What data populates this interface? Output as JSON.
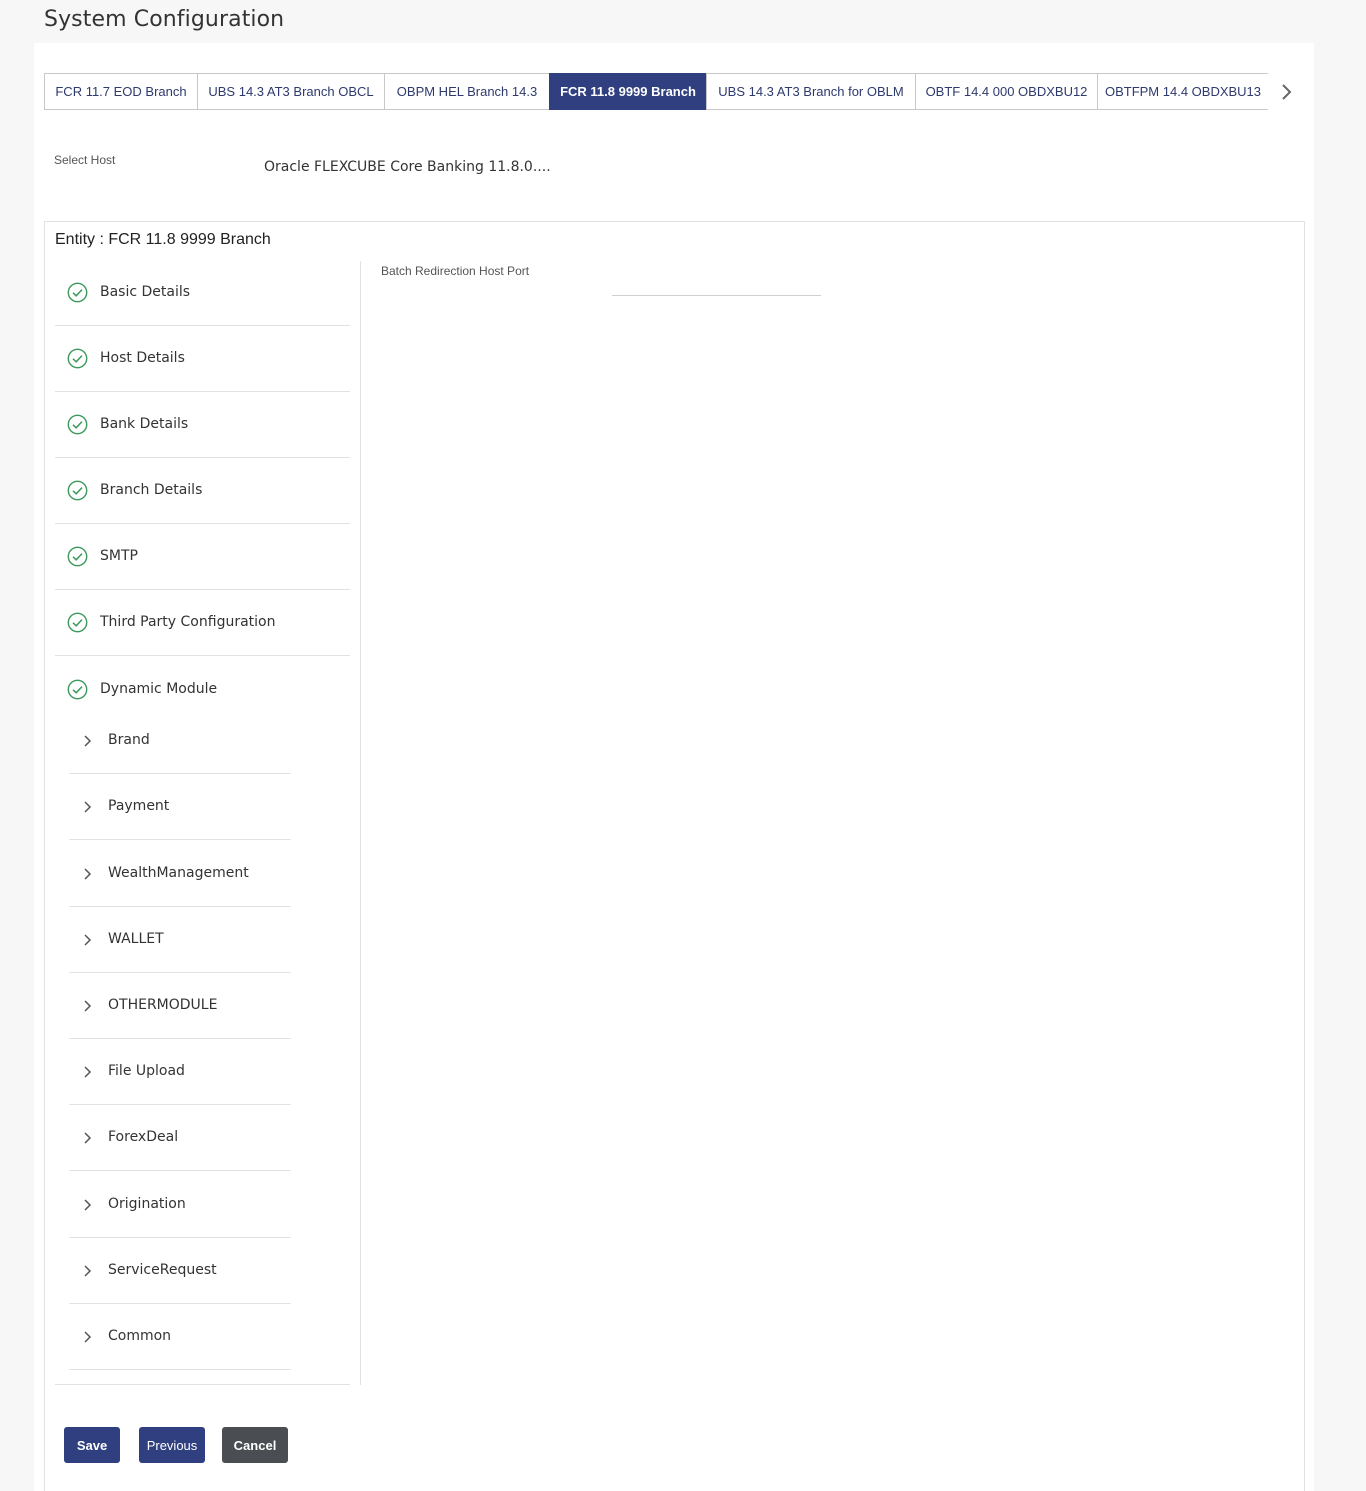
{
  "page": {
    "title": "System Configuration"
  },
  "tabs": [
    {
      "label": "FCR 11.7 EOD Branch",
      "active": false
    },
    {
      "label": "UBS 14.3 AT3 Branch OBCL",
      "active": false
    },
    {
      "label": "OBPM HEL Branch 14.3",
      "active": false
    },
    {
      "label": "FCR 11.8 9999 Branch",
      "active": true
    },
    {
      "label": "UBS 14.3 AT3 Branch for OBLM",
      "active": false
    },
    {
      "label": "OBTF 14.4 000 OBDXBU12",
      "active": false
    },
    {
      "label": "OBTFPM 14.4 OBDXBU13",
      "active": false
    }
  ],
  "host": {
    "label": "Select Host",
    "value": "Oracle FLEXCUBE Core Banking 11.8.0...."
  },
  "entity": {
    "title": "Entity : FCR 11.8 9999 Branch"
  },
  "steps": [
    {
      "label": "Basic Details",
      "status": "complete"
    },
    {
      "label": "Host Details",
      "status": "complete"
    },
    {
      "label": "Bank Details",
      "status": "complete"
    },
    {
      "label": "Branch Details",
      "status": "complete"
    },
    {
      "label": "SMTP",
      "status": "complete"
    },
    {
      "label": "Third Party Configuration",
      "status": "complete"
    },
    {
      "label": "Dynamic Module",
      "status": "complete"
    }
  ],
  "dynamic_modules": [
    "Brand",
    "Payment",
    "WealthManagement",
    "WALLET",
    "OTHERMODULE",
    "File Upload",
    "ForexDeal",
    "Origination",
    "ServiceRequest",
    "Common"
  ],
  "form": {
    "batch_redirection_host_port": {
      "label": "Batch Redirection Host Port",
      "value": ""
    }
  },
  "buttons": {
    "save": "Save",
    "previous": "Previous",
    "cancel": "Cancel"
  },
  "colors": {
    "primary": "#2f3f80",
    "success": "#3a9a5b",
    "cancel": "#4a4d52"
  }
}
